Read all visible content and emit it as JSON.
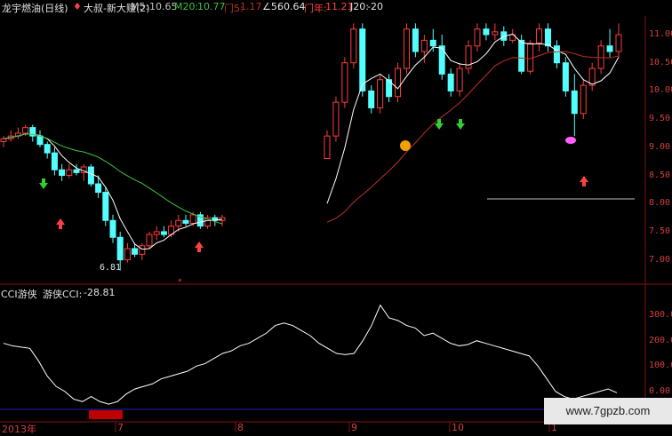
{
  "header": {
    "title": "龙宇燃油(日线)",
    "indicator": "大叔-新大赚(2)",
    "m5_label": "M5:",
    "m5_value": "10.65",
    "m20_label": "M20:",
    "m20_value": "10.77",
    "men5": "门5:",
    "men5_value": "1.17",
    "angle5": "∠5:",
    "angle5_value": "60.64",
    "mennian": "门年:",
    "mennian_value": "11.21",
    "j20": "J20:",
    "j20_value": "-20"
  },
  "price_axis": [
    "11.00",
    "10.50",
    "10.00",
    "9.50",
    "9.00",
    "8.50",
    "8.00",
    "7.50",
    "7.00"
  ],
  "low_label": "6.81",
  "cci_panel": {
    "title": "CCI游侠",
    "series_label": "游侠CCI:",
    "value": "-28.81",
    "axis": [
      "300.00",
      "200.00",
      "100.00",
      "0.00"
    ]
  },
  "time_axis": [
    "2013年",
    "7",
    "8",
    "9",
    "10",
    "1"
  ],
  "watermark": "www.7gpzb.com",
  "colors": {
    "up": "#ff3c3c",
    "down": "#54ffff",
    "ma5": "#ffffff",
    "ma20": "#40c040",
    "mennian": "#c03020",
    "grid": "#8a1010",
    "cci": "#ffffff",
    "baseline": "#2020c0"
  },
  "chart_data": {
    "type": "candlestick",
    "ylim": [
      6.6,
      11.3
    ],
    "candles": [
      [
        9.1,
        9.2,
        9.0,
        9.15
      ],
      [
        9.15,
        9.3,
        9.1,
        9.2
      ],
      [
        9.2,
        9.35,
        9.15,
        9.25
      ],
      [
        9.25,
        9.4,
        9.2,
        9.35
      ],
      [
        9.35,
        9.4,
        9.1,
        9.2
      ],
      [
        9.2,
        9.3,
        9.0,
        9.05
      ],
      [
        9.05,
        9.1,
        8.8,
        8.9
      ],
      [
        8.9,
        9.0,
        8.5,
        8.6
      ],
      [
        8.6,
        8.7,
        8.4,
        8.5
      ],
      [
        8.5,
        8.7,
        8.45,
        8.6
      ],
      [
        8.6,
        8.7,
        8.5,
        8.55
      ],
      [
        8.55,
        8.7,
        8.4,
        8.65
      ],
      [
        8.65,
        8.7,
        8.3,
        8.35
      ],
      [
        8.35,
        8.5,
        8.1,
        8.2
      ],
      [
        8.2,
        8.3,
        7.6,
        7.7
      ],
      [
        7.7,
        7.8,
        7.3,
        7.4
      ],
      [
        7.4,
        7.5,
        6.81,
        7.0
      ],
      [
        7.0,
        7.3,
        6.95,
        7.2
      ],
      [
        7.2,
        7.3,
        7.05,
        7.1
      ],
      [
        7.1,
        7.3,
        7.0,
        7.25
      ],
      [
        7.25,
        7.5,
        7.2,
        7.45
      ],
      [
        7.45,
        7.6,
        7.35,
        7.5
      ],
      [
        7.5,
        7.6,
        7.4,
        7.45
      ],
      [
        7.45,
        7.7,
        7.4,
        7.6
      ],
      [
        7.6,
        7.8,
        7.5,
        7.7
      ],
      [
        7.7,
        7.8,
        7.6,
        7.65
      ],
      [
        7.65,
        7.85,
        7.6,
        7.8
      ],
      [
        7.8,
        7.85,
        7.55,
        7.6
      ],
      [
        7.6,
        7.8,
        7.55,
        7.75
      ],
      [
        7.75,
        7.8,
        7.6,
        7.7
      ],
      [
        7.7,
        7.8,
        7.6,
        7.75
      ],
      [
        8.8,
        9.3,
        8.8,
        9.2
      ],
      [
        9.2,
        9.9,
        9.1,
        9.8
      ],
      [
        9.8,
        10.6,
        9.7,
        10.5
      ],
      [
        10.5,
        11.2,
        10.4,
        11.1
      ],
      [
        11.1,
        11.2,
        9.9,
        10.0
      ],
      [
        10.0,
        10.1,
        9.6,
        9.7
      ],
      [
        9.7,
        10.3,
        9.6,
        10.2
      ],
      [
        10.2,
        10.3,
        9.8,
        9.9
      ],
      [
        9.9,
        10.5,
        9.8,
        10.4
      ],
      [
        10.4,
        11.2,
        10.3,
        11.1
      ],
      [
        11.1,
        11.2,
        10.6,
        10.7
      ],
      [
        10.7,
        11.0,
        10.5,
        10.9
      ],
      [
        10.9,
        11.1,
        10.7,
        10.8
      ],
      [
        10.8,
        11.0,
        10.2,
        10.3
      ],
      [
        10.3,
        10.4,
        9.9,
        10.0
      ],
      [
        10.0,
        10.5,
        9.9,
        10.4
      ],
      [
        10.4,
        10.9,
        10.3,
        10.8
      ],
      [
        10.8,
        11.2,
        10.7,
        11.1
      ],
      [
        11.1,
        11.2,
        10.9,
        11.0
      ],
      [
        11.0,
        11.2,
        10.9,
        11.05
      ],
      [
        11.05,
        11.15,
        10.8,
        10.9
      ],
      [
        10.9,
        11.1,
        10.85,
        11.0
      ],
      [
        10.9,
        11.0,
        10.3,
        10.35
      ],
      [
        10.35,
        10.9,
        10.3,
        10.85
      ],
      [
        10.85,
        11.2,
        10.7,
        11.1
      ],
      [
        11.1,
        11.2,
        10.7,
        10.8
      ],
      [
        10.8,
        10.9,
        10.4,
        10.5
      ],
      [
        10.5,
        10.6,
        9.9,
        10.0
      ],
      [
        10.0,
        10.3,
        9.2,
        9.6
      ],
      [
        9.6,
        10.2,
        9.5,
        10.1
      ],
      [
        10.1,
        10.5,
        10.0,
        10.4
      ],
      [
        10.4,
        10.9,
        10.3,
        10.8
      ],
      [
        10.8,
        11.1,
        10.6,
        10.7
      ],
      [
        10.7,
        11.2,
        10.6,
        11.0
      ]
    ],
    "cci": [
      190,
      180,
      175,
      170,
      120,
      60,
      20,
      0,
      -30,
      -40,
      -20,
      -40,
      -50,
      -40,
      -10,
      10,
      20,
      30,
      50,
      60,
      70,
      80,
      100,
      110,
      130,
      150,
      160,
      180,
      190,
      210,
      230,
      260,
      270,
      260,
      240,
      220,
      190,
      170,
      150,
      145,
      150,
      200,
      260,
      340,
      290,
      280,
      260,
      250,
      220,
      230,
      210,
      190,
      180,
      185,
      200,
      190,
      180,
      170,
      160,
      150,
      140,
      100,
      50,
      0,
      -20,
      -30,
      -20,
      -10,
      0,
      10,
      -5
    ]
  }
}
